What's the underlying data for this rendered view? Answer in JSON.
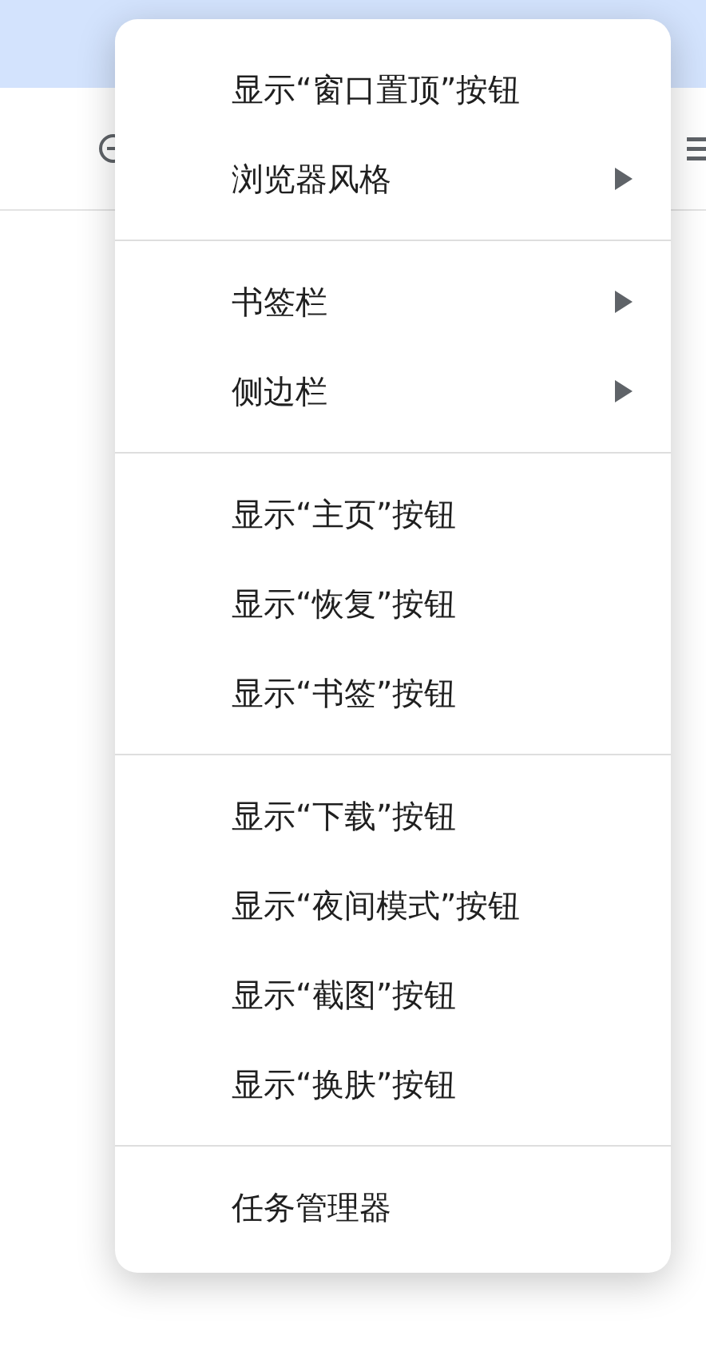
{
  "menu": {
    "groups": [
      {
        "items": [
          {
            "label": "显示“窗口置顶”按钮",
            "kind": "command"
          },
          {
            "label": "浏览器风格",
            "kind": "submenu"
          }
        ]
      },
      {
        "items": [
          {
            "label": "书签栏",
            "kind": "submenu"
          },
          {
            "label": "侧边栏",
            "kind": "submenu"
          }
        ]
      },
      {
        "items": [
          {
            "label": "显示“主页”按钮",
            "kind": "command"
          },
          {
            "label": "显示“恢复”按钮",
            "kind": "command"
          },
          {
            "label": "显示“书签”按钮",
            "kind": "command"
          }
        ]
      },
      {
        "items": [
          {
            "label": "显示“下载”按钮",
            "kind": "command"
          },
          {
            "label": "显示“夜间模式”按钮",
            "kind": "command"
          },
          {
            "label": "显示“截图”按钮",
            "kind": "command"
          },
          {
            "label": "显示“换肤”按钮",
            "kind": "command"
          }
        ]
      },
      {
        "items": [
          {
            "label": "任务管理器",
            "kind": "command"
          }
        ]
      }
    ]
  }
}
